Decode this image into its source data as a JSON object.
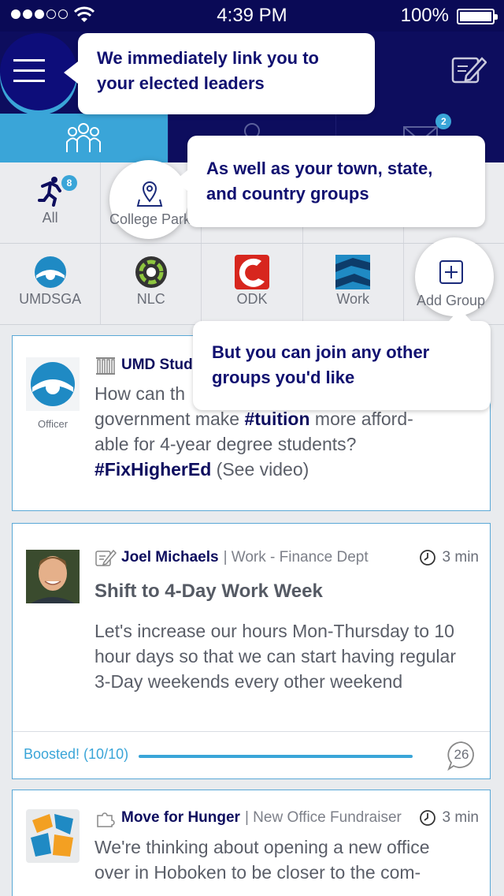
{
  "status_bar": {
    "time": "4:39 PM",
    "battery": "100%"
  },
  "tabs": [
    {
      "name": "groups",
      "active": true
    },
    {
      "name": "profile",
      "active": false
    },
    {
      "name": "messages",
      "active": false,
      "badge": "2"
    }
  ],
  "groups_row1": [
    {
      "label": "All",
      "badge": "8",
      "icon": "runner-icon"
    },
    {
      "label": "College Park",
      "icon": "map-pin-icon"
    },
    {
      "label": "",
      "icon": ""
    },
    {
      "label": "",
      "icon": ""
    },
    {
      "label": "",
      "icon": ""
    }
  ],
  "groups_row2": [
    {
      "label": "UMDSGA",
      "icon": "umdsga-logo"
    },
    {
      "label": "NLC",
      "icon": "nlc-logo"
    },
    {
      "label": "ODK",
      "icon": "odk-logo"
    },
    {
      "label": "Work",
      "icon": "work-logo"
    },
    {
      "label": "Add Group",
      "icon": "plus-square-icon"
    }
  ],
  "tooltips": {
    "leaders": "We immediately link you to your elected leaders",
    "groups": "As well as your town, state, and country groups",
    "join": "But you can join any other groups you'd like"
  },
  "posts": [
    {
      "author": "UMD Stud",
      "role": "Officer",
      "body_prefix": "How can th",
      "body_line2a": "government make ",
      "tag1": "#tuition",
      "body_line2b": " more afford-",
      "body_line3": "able for 4-year degree students?",
      "tag2": "#FixHigherEd",
      "body_end": " (See video)"
    },
    {
      "author": "Joel Michaels",
      "group": "| Work - Finance Dept",
      "time": "3 min",
      "title": "Shift to 4-Day Work Week",
      "body": "Let's increase our hours Mon-Thursday to 10 hour days so that we can start having regular 3-Day weekends every other weekend",
      "boost": "Boosted! (10/10)",
      "comments": "26"
    },
    {
      "author": "Move for Hunger",
      "group": "| New Office Fundraiser",
      "time": "3 min",
      "body": "We're thinking about opening a new office over in Hoboken to be closer to the com-"
    }
  ],
  "colors": {
    "navy": "#0d0d5e",
    "accent": "#3aa5d8"
  }
}
